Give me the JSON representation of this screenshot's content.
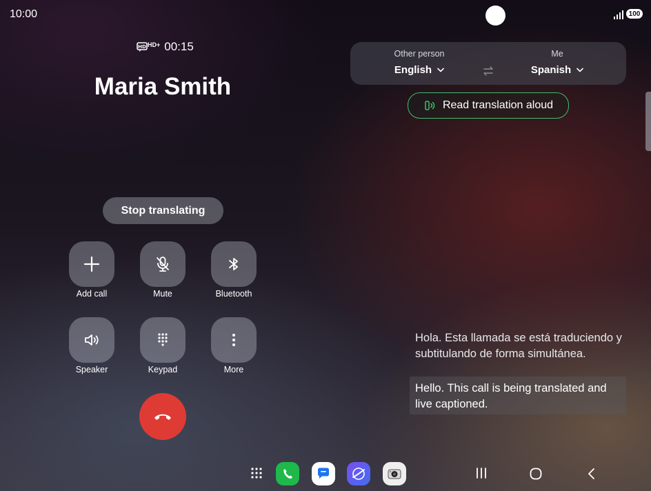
{
  "status_bar": {
    "time": "10:00",
    "battery": "100"
  },
  "call": {
    "hd_badge": "HD+",
    "duration": "00:15",
    "caller_name": "Maria Smith"
  },
  "translation": {
    "other_label": "Other person",
    "other_language": "English",
    "me_label": "Me",
    "me_language": "Spanish",
    "read_aloud_label": "Read translation aloud",
    "stop_label": "Stop translating"
  },
  "controls": {
    "add_call": "Add call",
    "mute": "Mute",
    "bluetooth": "Bluetooth",
    "speaker": "Speaker",
    "keypad": "Keypad",
    "more": "More"
  },
  "captions": {
    "spanish": "Hola. Esta llamada se está traduciendo y subtitulando de forma simultánea.",
    "english": "Hello. This call is being translated and live captioned."
  },
  "colors": {
    "end_call": "#de3b35",
    "accent_green": "#3fbf6a",
    "phone_app": "#1fb84a",
    "messages_app": "#1e73f0"
  },
  "taskbar": {
    "apps": [
      "apps-grid-icon",
      "phone-app-icon",
      "messages-app-icon",
      "internet-app-icon",
      "camera-app-icon"
    ]
  }
}
